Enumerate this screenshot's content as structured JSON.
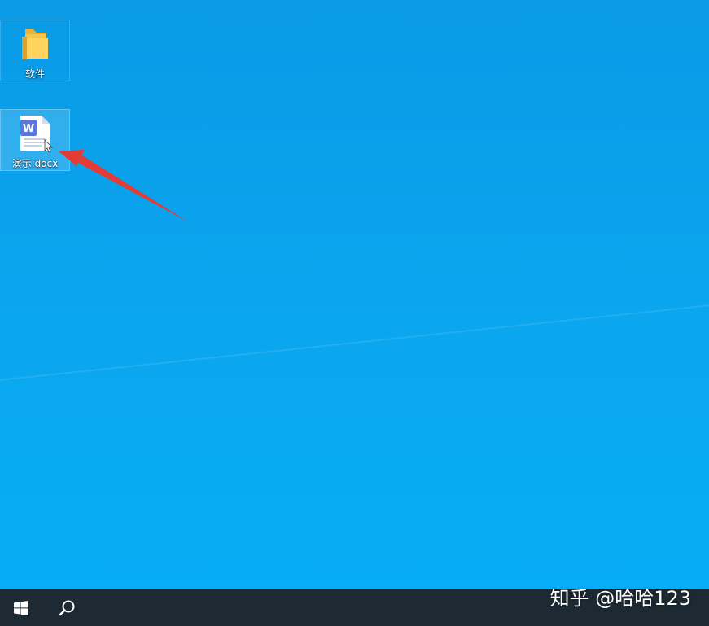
{
  "desktop": {
    "icons": [
      {
        "label": "软件",
        "icon": "folder-icon"
      },
      {
        "label": "演示.docx",
        "icon": "word-document-icon"
      }
    ],
    "annotation": {
      "icon": "red-arrow-icon",
      "color": "#e63a35"
    }
  },
  "taskbar": {
    "start_icon": "windows-logo-icon",
    "search_icon": "search-icon"
  },
  "watermark": {
    "text": "知乎 @哈哈123"
  },
  "colors": {
    "desktop_background": "#0aa3ec",
    "taskbar": "#1d2a33",
    "arrow": "#e63a35"
  }
}
